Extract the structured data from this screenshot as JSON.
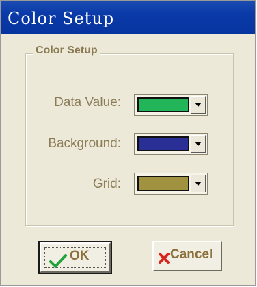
{
  "window": {
    "title": "Color Setup"
  },
  "group": {
    "legend": "Color Setup",
    "rows": [
      {
        "label": "Data  Value:",
        "color": "#22b55a",
        "color_icon": "color-swatch"
      },
      {
        "label": "Background:",
        "color": "#2a2f95",
        "color_icon": "color-swatch"
      },
      {
        "label": "Grid:",
        "color": "#a0923e",
        "color_icon": "color-swatch"
      }
    ]
  },
  "buttons": {
    "ok_label": "OK",
    "ok_icon": "checkmark-icon",
    "cancel_label": "Cancel",
    "cancel_icon": "x-mark-icon"
  },
  "colors": {
    "title_bar": "#0a3aa8",
    "dialog_bg": "#ede9d9",
    "label_text": "#8c7d58",
    "check": "#1fa33c",
    "x_mark": "#d9261c"
  }
}
